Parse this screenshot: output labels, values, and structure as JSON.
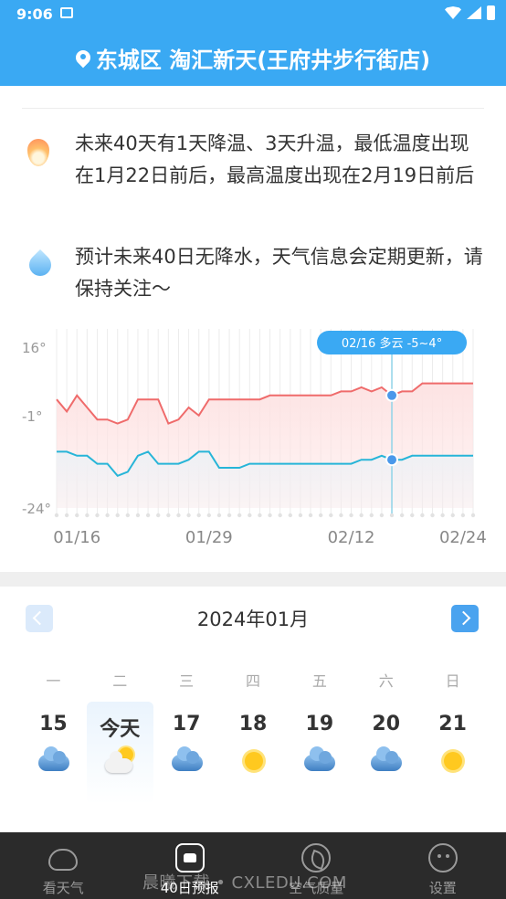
{
  "status_bar": {
    "time": "9:06"
  },
  "header": {
    "location": "东城区 淘汇新天(王府井步行街店)"
  },
  "summary": {
    "temperature_text": "未来40天有1天降温、3天升温，最低温度出现在1月22日前后，最高温度出现在2月19日前后",
    "precip_text": "预计未来40日无降水，天气信息会定期更新，请保持关注～"
  },
  "chart_data": {
    "type": "line",
    "y_tick_labels": [
      "16°",
      "-1°",
      "-24°"
    ],
    "y_ticks": [
      16,
      -1,
      -24
    ],
    "ylim": [
      -24,
      16
    ],
    "x_tick_labels": [
      "01/16",
      "01/29",
      "02/12",
      "02/24"
    ],
    "x_tick_index": [
      2,
      15,
      29,
      40
    ],
    "tooltip": {
      "text": "02/16 多云 -5~4°",
      "index": 33
    },
    "colors": {
      "high": "#ef6b6b",
      "low": "#27b5d8",
      "high_fill": "#fde3e3",
      "low_fill": "#eef1f5"
    },
    "series": [
      {
        "name": "high",
        "values": [
          3,
          0,
          4,
          1,
          -2,
          -2,
          -3,
          -2,
          3,
          3,
          3,
          -3,
          -2,
          1,
          -1,
          3,
          3,
          3,
          3,
          3,
          3,
          4,
          4,
          4,
          4,
          4,
          4,
          4,
          5,
          5,
          6,
          5,
          6,
          4,
          5,
          5,
          7,
          7,
          7,
          7,
          7,
          7
        ]
      },
      {
        "name": "low",
        "values": [
          -10,
          -10,
          -11,
          -11,
          -13,
          -13,
          -16,
          -15,
          -11,
          -10,
          -13,
          -13,
          -13,
          -12,
          -10,
          -10,
          -14,
          -14,
          -14,
          -13,
          -13,
          -13,
          -13,
          -13,
          -13,
          -13,
          -13,
          -13,
          -13,
          -13,
          -12,
          -12,
          -11,
          -12,
          -12,
          -11,
          -11,
          -11,
          -11,
          -11,
          -11,
          -11
        ]
      }
    ]
  },
  "calendar": {
    "month_title": "2024年01月",
    "weekdays": [
      "一",
      "二",
      "三",
      "四",
      "五",
      "六",
      "日"
    ],
    "days": [
      {
        "label": "15",
        "weather_icon": "cloudy-icon"
      },
      {
        "label": "今天",
        "weather_icon": "partly-cloudy-icon"
      },
      {
        "label": "17",
        "weather_icon": "cloudy-icon"
      },
      {
        "label": "18",
        "weather_icon": "sunny-icon"
      },
      {
        "label": "19",
        "weather_icon": "cloudy-icon"
      },
      {
        "label": "20",
        "weather_icon": "cloudy-icon"
      },
      {
        "label": "21",
        "weather_icon": "sunny-icon"
      }
    ]
  },
  "bottom_nav": {
    "items": [
      {
        "label": "看天气",
        "icon": "cloud-icon"
      },
      {
        "label": "40日预报",
        "icon": "house-icon"
      },
      {
        "label": "空气质量",
        "icon": "leaf-icon"
      },
      {
        "label": "设置",
        "icon": "face-icon"
      }
    ]
  },
  "watermark": "晨曦下载 • CXLEDU.COM"
}
